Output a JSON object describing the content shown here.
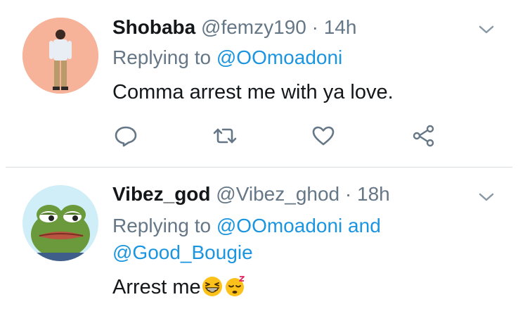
{
  "tweets": [
    {
      "name": "Shobaba",
      "handle": "@femzy190",
      "dot": "·",
      "time": "14h",
      "replying_prefix": "Replying to",
      "replying_user": "@OOmoadoni",
      "text": "Comma arrest me with ya love."
    },
    {
      "name": "Vibez_god",
      "handle": "@Vibez_ghod",
      "dot": "·",
      "time": "18h",
      "replying_prefix": "Replying to",
      "replying_user": "@OOmoadoni",
      "replying_and": "and",
      "replying_user2": "@Good_Bougie",
      "text": "Arrest me",
      "emojis": [
        "grinning-squint-emoji",
        "sleepy-emoji"
      ]
    }
  ],
  "icons": [
    "reply-icon",
    "retweet-icon",
    "like-icon",
    "share-icon",
    "chevron-down-icon"
  ],
  "colors": {
    "link": "#1b95e0",
    "muted": "#657786",
    "text": "#14171a",
    "divider": "#d8dee3"
  }
}
